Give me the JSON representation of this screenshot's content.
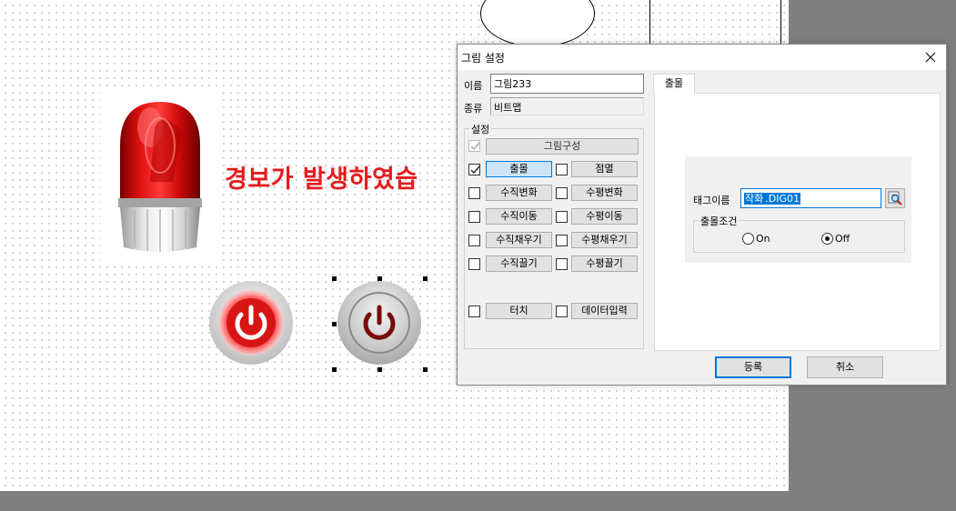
{
  "canvas": {
    "warning_text": "경보가 발생하였습"
  },
  "dialog": {
    "title": "그림 설정",
    "name_label": "이름",
    "name_value": "그림233",
    "type_label": "종류",
    "type_value": "비트맵",
    "settings_group_label": "설정",
    "options": [
      {
        "label": "그림구성",
        "checked": true,
        "disabled": true
      },
      {
        "label": "출몰",
        "checked": true,
        "active": true
      },
      {
        "label": "점멸",
        "checked": false
      },
      {
        "label": "수직변화",
        "checked": false
      },
      {
        "label": "수평변화",
        "checked": false
      },
      {
        "label": "수직이동",
        "checked": false
      },
      {
        "label": "수평이동",
        "checked": false
      },
      {
        "label": "수직채우기",
        "checked": false
      },
      {
        "label": "수평채우기",
        "checked": false
      },
      {
        "label": "수직끌기",
        "checked": false
      },
      {
        "label": "수평끌기",
        "checked": false
      },
      {
        "label": "터치",
        "checked": false
      },
      {
        "label": "데이터입력",
        "checked": false
      }
    ],
    "tab_label": "출몰",
    "tag_label": "태그이름",
    "tag_value_selected": "작화",
    "tag_value_rest": ".DIG01",
    "condition_group_label": "출몰조건",
    "radio_on_label": "On",
    "radio_off_label": "Off",
    "selected_condition": "Off",
    "register_button": "등록",
    "cancel_button": "취소"
  },
  "colors": {
    "warning_red": "#e41b1b",
    "accent_blue": "#0078d7",
    "dialog_bg": "#f0f0f0"
  }
}
